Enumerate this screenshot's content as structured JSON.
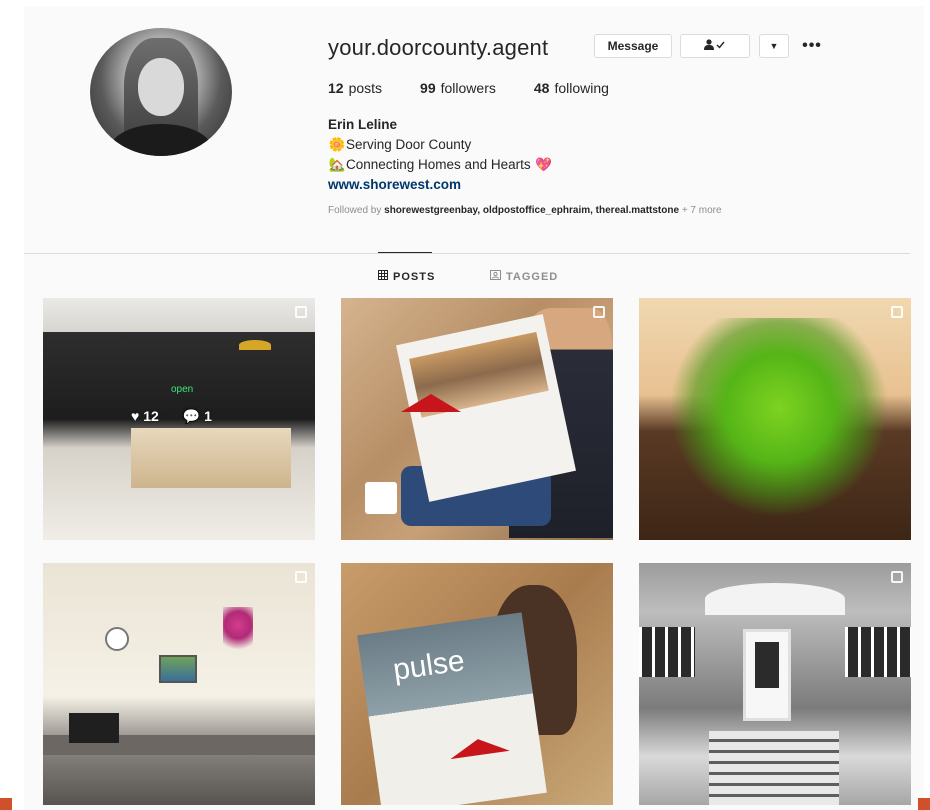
{
  "profile": {
    "username": "your.doorcounty.agent",
    "buttons": {
      "message": "Message",
      "following_icon": "person-check-icon",
      "caret": "▼",
      "more": "•••"
    },
    "stats": {
      "posts_count": "12",
      "posts_label": "posts",
      "followers_count": "99",
      "followers_label": "followers",
      "following_count": "48",
      "following_label": "following"
    },
    "bio": {
      "name": "Erin Leline",
      "line1_emoji": "🌼",
      "line1": "Serving Door County",
      "line2_emoji": "🏡",
      "line2": "Connecting Homes and Hearts",
      "line2_end_emoji": "💖",
      "link": "www.shorewest.com"
    },
    "followed_by": {
      "prefix": "Followed by",
      "names": "shorewestgreenbay, oldpostoffice_ephraim, thereal.mattstone",
      "more": "+ 7 more"
    }
  },
  "tabs": [
    {
      "label": "POSTS",
      "icon": "grid-icon",
      "active": true
    },
    {
      "label": "TAGGED",
      "icon": "tag-portrait-icon",
      "active": false
    }
  ],
  "posts": [
    {
      "subject": "office-interior",
      "likes": "12",
      "comments": "1",
      "multi": true,
      "neon": "open"
    },
    {
      "subject": "woman-reading-pulse",
      "multi": true
    },
    {
      "subject": "fern-plant",
      "multi": true
    },
    {
      "subject": "home-office-desk",
      "multi": true
    },
    {
      "subject": "woman-behind-pulse",
      "multi": false,
      "cover_text": "pulse"
    },
    {
      "subject": "black-white-house",
      "multi": true
    }
  ],
  "colors": {
    "link": "#00376b",
    "muted": "#8e8e8e",
    "border": "#dbdbdb",
    "heart": "#ed4956"
  }
}
